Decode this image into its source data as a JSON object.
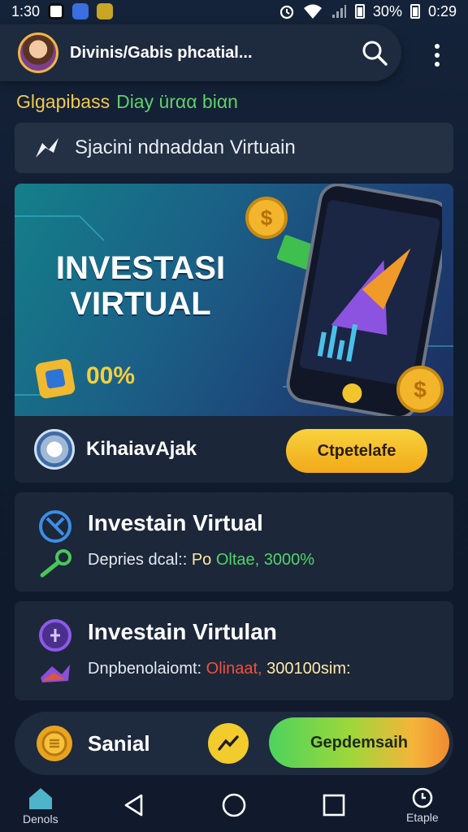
{
  "status_bar": {
    "time": "1:30",
    "battery_text": "30%",
    "clock": "0:29"
  },
  "header": {
    "title": "Divinis/Gabis phcatial..."
  },
  "subline": {
    "part1": "Glgapibass",
    "part2": "Diay ürαα biαn"
  },
  "search": {
    "text": "Sjacini ndnaddan Virtuain"
  },
  "hero": {
    "title_line1": "INVESTASI",
    "title_line2": "VIRTUAL",
    "percent": "00%"
  },
  "promo": {
    "label": "KihaiavAjak",
    "button": "Ctpetelafe"
  },
  "cards": [
    {
      "title": "Investain Virtual",
      "sub_label": "Depries dcal::",
      "sub_value1": "Po",
      "sub_value2": "Oltae,",
      "sub_value3": "3000%"
    },
    {
      "title": "Investain Virtulan",
      "sub_label": "Dnpbenolaiomt:",
      "sub_value1": "Olinaat,",
      "sub_value2": "300100sim:"
    }
  ],
  "bottom_bar": {
    "label": "Sanial",
    "cta": "Gepdemsaih"
  },
  "navbar": {
    "home_label": "Denols",
    "right_label": "Etaple"
  },
  "colors": {
    "accent_yellow": "#f2c94c",
    "accent_green": "#5fd068",
    "card_bg": "#1c2739",
    "page_bg": "#15233a"
  }
}
